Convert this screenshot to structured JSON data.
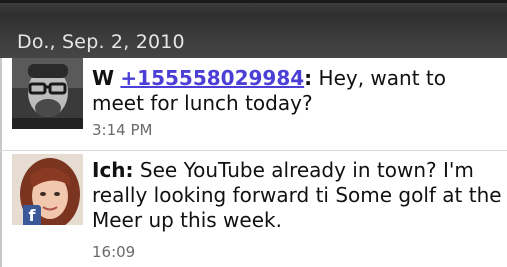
{
  "header": {
    "date": "Do., Sep. 2, 2010"
  },
  "messages": [
    {
      "sender": "W",
      "number": "+155558029984",
      "text": " Hey, want to meet for lunch today?",
      "time": "3:14 PM",
      "avatar": "man-with-glasses-photo",
      "badge": null
    },
    {
      "sender": "Ich:",
      "text": " See YouTube already in town? I'm really looking forward ti Some golf at the Meer up this week.",
      "time": "16:09",
      "avatar": "woman-photo",
      "badge": "f"
    }
  ]
}
